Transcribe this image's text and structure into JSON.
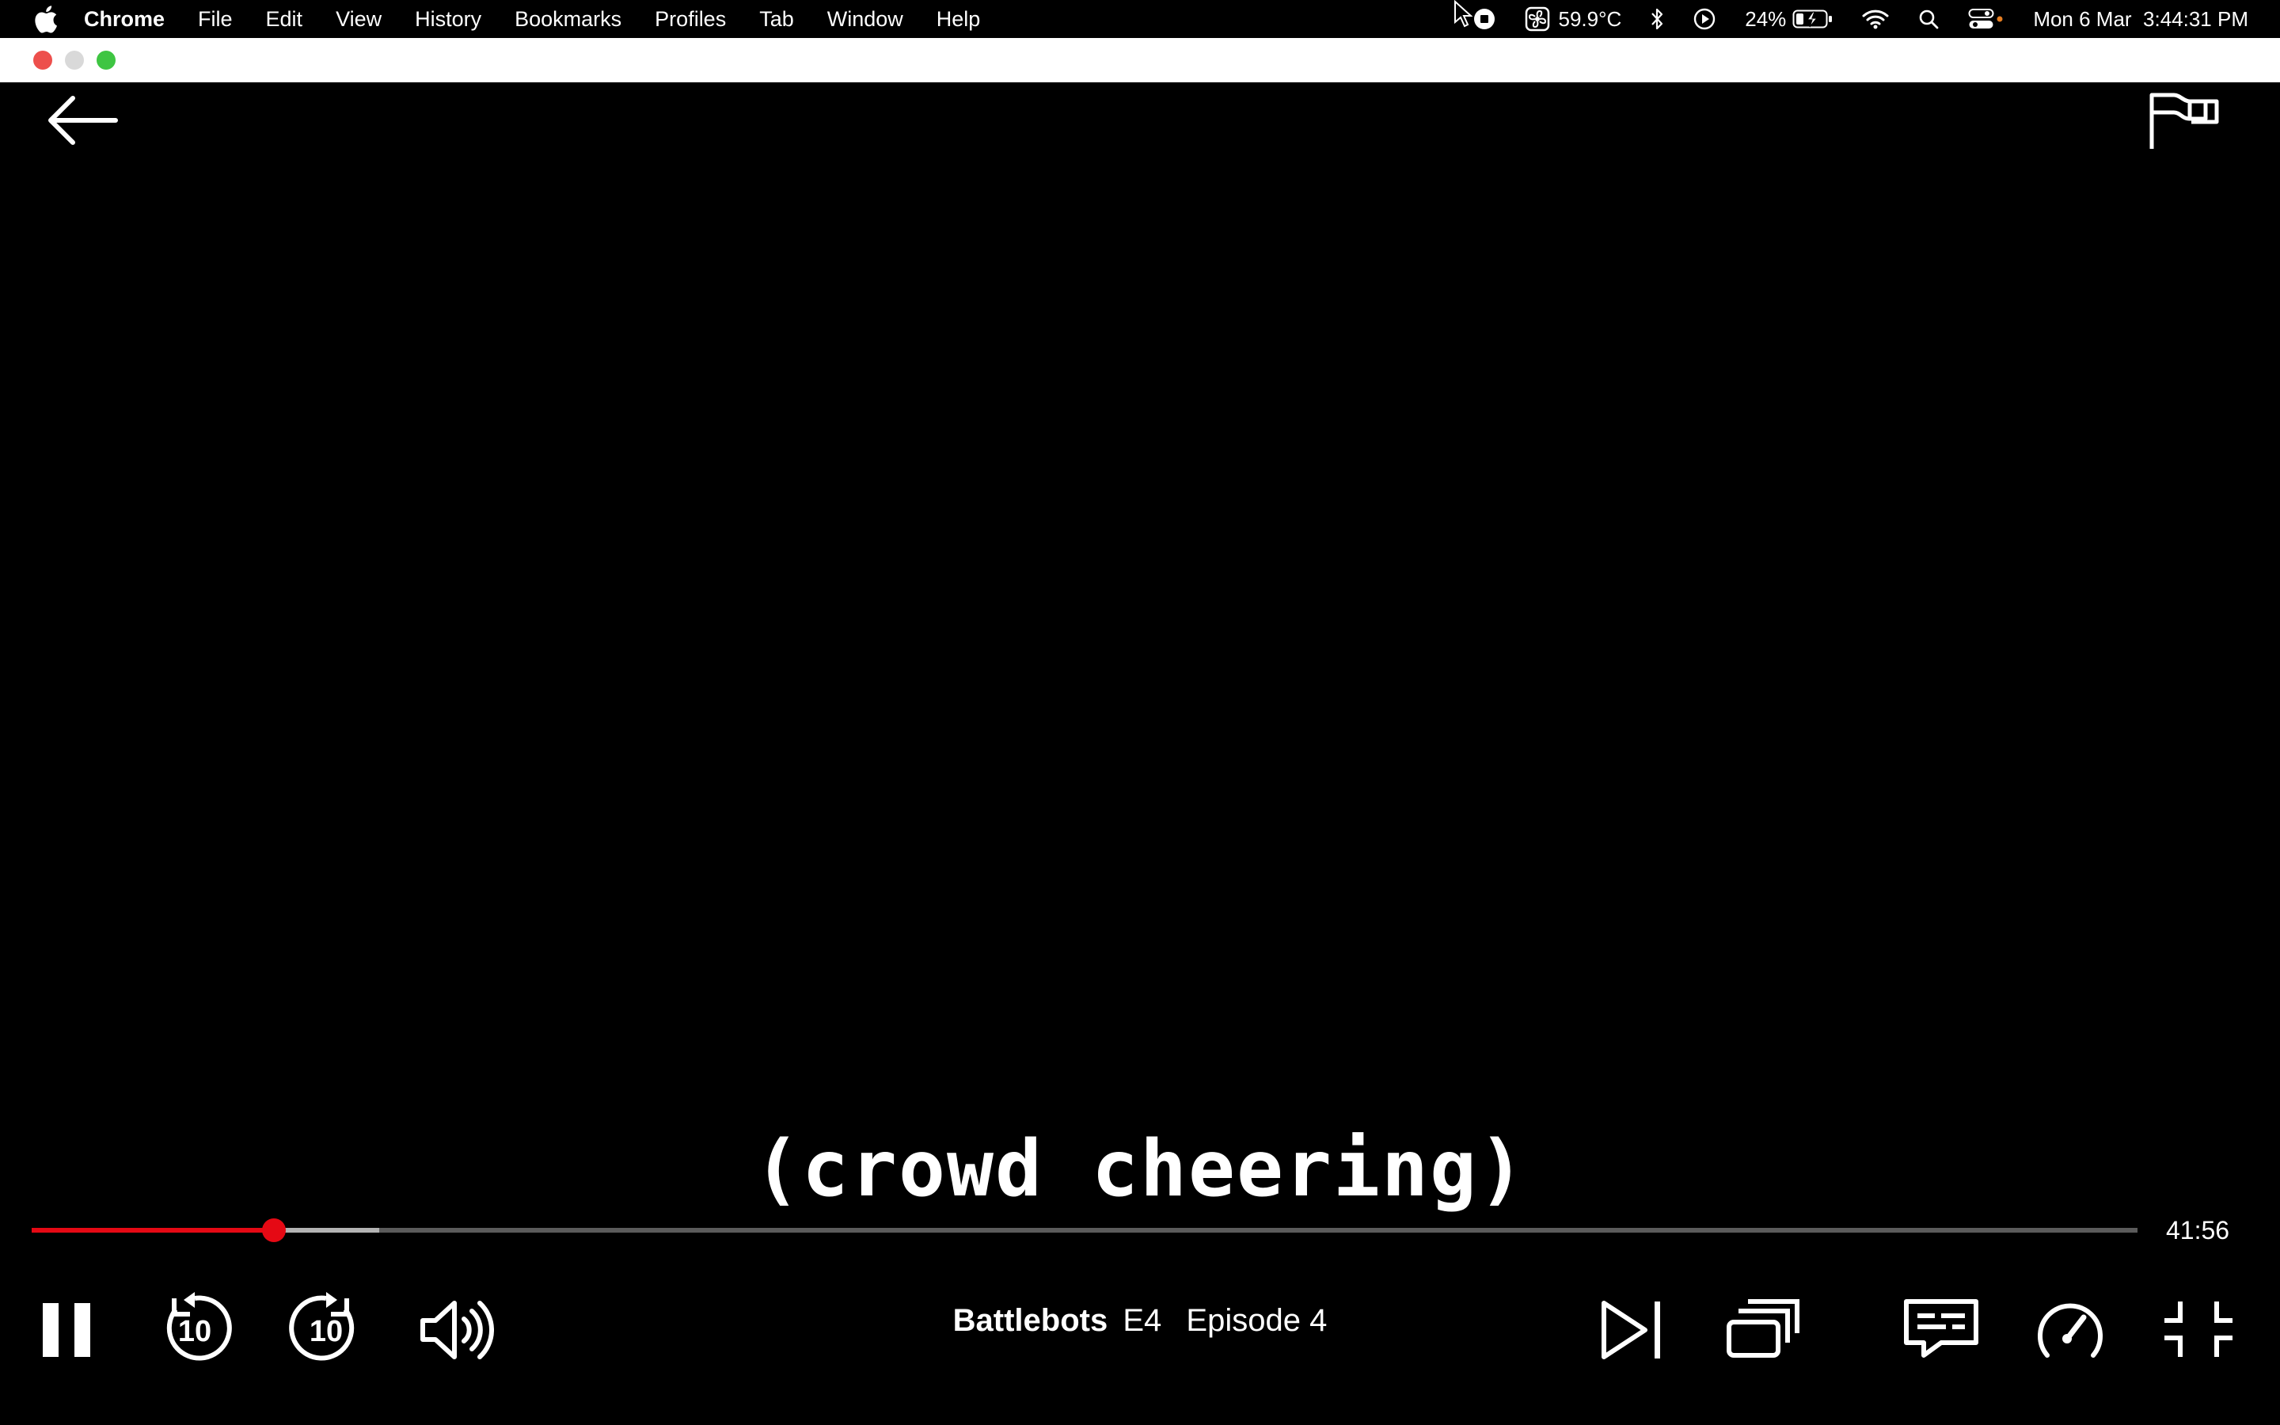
{
  "menubar": {
    "app_name": "Chrome",
    "items": [
      "File",
      "Edit",
      "View",
      "History",
      "Bookmarks",
      "Profiles",
      "Tab",
      "Window",
      "Help"
    ],
    "status": {
      "temperature": "59.9°C",
      "battery_percent": "24%",
      "datetime": "Mon 6 Mar  3:44:31 PM"
    }
  },
  "player": {
    "subtitle": "(crowd cheering)",
    "time_remaining": "41:56",
    "progress": {
      "played_fraction": 0.115,
      "buffered_fraction": 0.165
    },
    "show_title": "Battlebots",
    "episode_code": "E4",
    "episode_name": "Episode 4",
    "skip_seconds": "10",
    "accent_color": "#e50914"
  }
}
